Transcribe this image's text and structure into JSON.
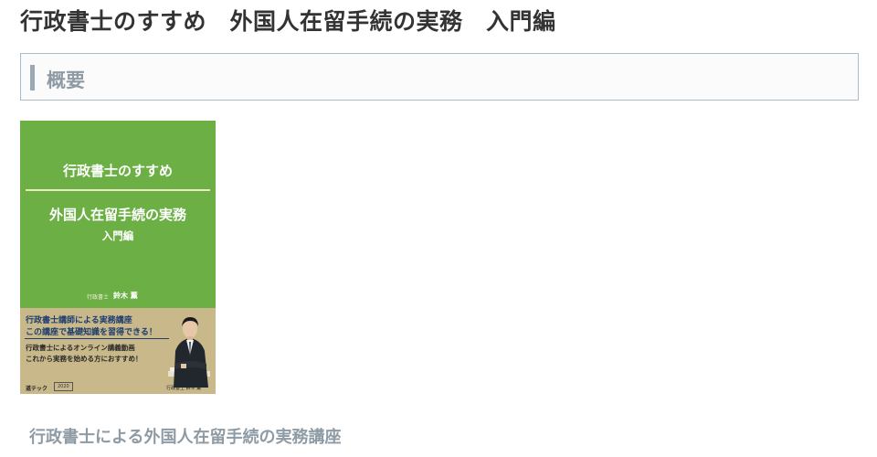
{
  "page": {
    "title": "行政書士のすすめ　外国人在留手続の実務　入門編"
  },
  "section": {
    "heading": "概要"
  },
  "cover": {
    "title": "行政書士のすすめ",
    "subtitle": "外国人在留手続の実務",
    "edition": "入門編",
    "author_role": "行政書士",
    "author_name": "鈴木 薫",
    "tagline1": "行政書士講師による実務講座",
    "tagline2": "この講座で基礎知識を習得できる！",
    "tagline3": "行政書士によるオンライン講義動画",
    "tagline4": "これから実務を始める方におすすめ！",
    "publisher": "道テック",
    "code": "2020",
    "tan_author": "行政書士 鈴木 薫",
    "colors": {
      "green": "#6caf44",
      "tan": "#c9b98a",
      "navy": "#1d3c6f"
    }
  },
  "caption": {
    "text": "行政書士による外国人在留手続の実務講座"
  }
}
